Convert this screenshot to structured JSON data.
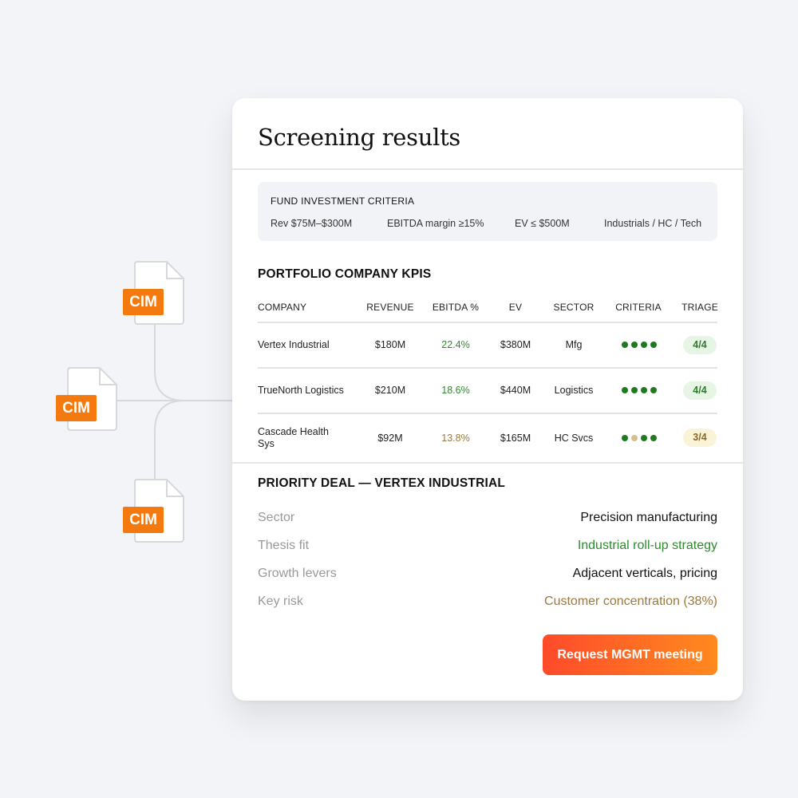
{
  "documents": [
    {
      "label": "CIM"
    },
    {
      "label": "CIM"
    },
    {
      "label": "CIM"
    }
  ],
  "card": {
    "title": "Screening results",
    "criteria": {
      "title": "FUND INVESTMENT CRITERIA",
      "items": [
        "Rev $75M–$300M",
        "EBITDA margin ≥15%",
        "EV ≤ $500M",
        "Industrials / HC / Tech"
      ]
    },
    "kpis": {
      "title": "PORTFOLIO COMPANY KPIS",
      "headers": [
        "COMPANY",
        "REVENUE",
        "EBITDA %",
        "EV",
        "SECTOR",
        "CRITERIA",
        "TRIAGE"
      ],
      "rows": [
        {
          "company": "Vertex Industrial",
          "revenue": "$180M",
          "ebitda": "22.4%",
          "ev": "$380M",
          "sector": "Mfg",
          "criteria_met": 4,
          "criteria_total": 4,
          "triage": "4/4"
        },
        {
          "company": "TrueNorth Logistics",
          "revenue": "$210M",
          "ebitda": "18.6%",
          "ev": "$440M",
          "sector": "Logistics",
          "criteria_met": 4,
          "criteria_total": 4,
          "triage": "4/4"
        },
        {
          "company": "Cascade Health Sys",
          "revenue": "$92M",
          "ebitda": "13.8%",
          "ev": "$165M",
          "sector": "HC Svcs",
          "criteria_met": 3,
          "criteria_total": 4,
          "triage": "3/4"
        }
      ]
    },
    "priority": {
      "title": "PRIORITY DEAL — VERTEX INDUSTRIAL",
      "fields": [
        {
          "label": "Sector",
          "value": "Precision manufacturing"
        },
        {
          "label": "Thesis fit",
          "value": "Industrial roll-up strategy"
        },
        {
          "label": "Growth levers",
          "value": "Adjacent verticals, pricing"
        },
        {
          "label": "Key risk",
          "value": "Customer concentration (38%)"
        }
      ]
    },
    "cta_label": "Request MGMT meeting"
  },
  "colors": {
    "accent_orange": "#f47a10",
    "cta_gradient_start": "#ff4a2a",
    "cta_gradient_end": "#ff8a1e",
    "positive_green": "#2e8b2e",
    "caution_amber": "#9b7a3c"
  }
}
